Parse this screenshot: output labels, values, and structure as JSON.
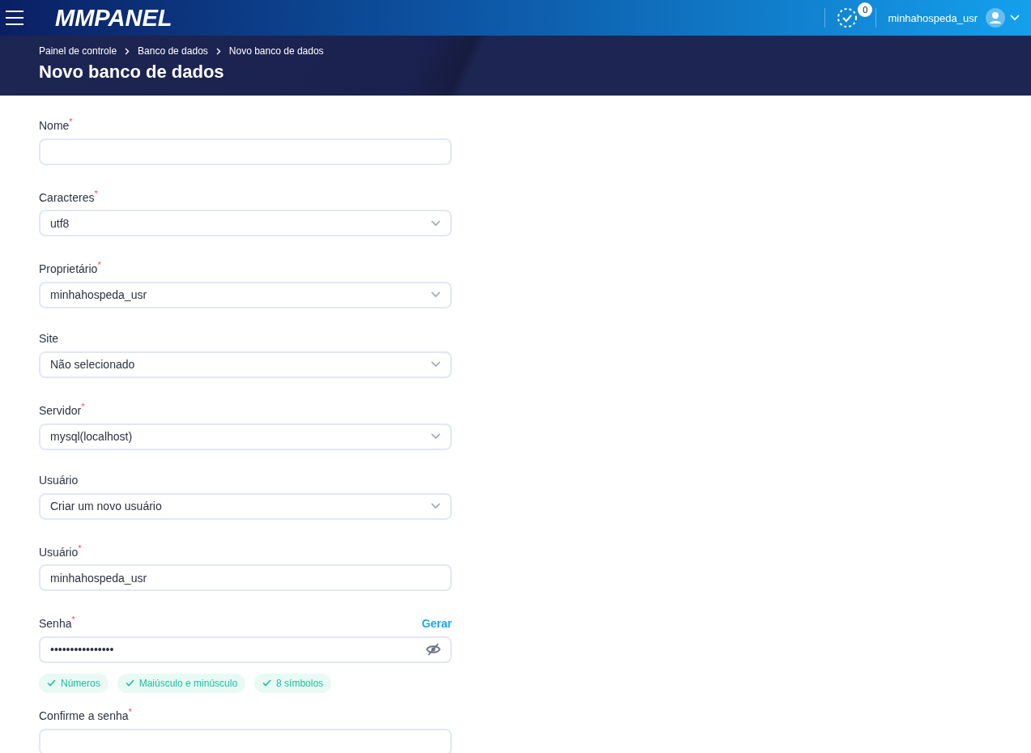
{
  "topbar": {
    "logo": "MMPANEL",
    "notifications_count": "0",
    "username": "minhahospeda_usr"
  },
  "breadcrumb": [
    "Painel de controle",
    "Banco de dados",
    "Novo banco de dados"
  ],
  "page_title": "Novo banco de dados",
  "fields": [
    {
      "kind": "text",
      "label": "Nome",
      "required_mark": "*"
    },
    {
      "kind": "select",
      "label": "Caracteres",
      "required_mark": "*",
      "value": "utf8"
    },
    {
      "kind": "select",
      "label": "Proprietário",
      "required_mark": "*",
      "value": "minhahospeda_usr"
    },
    {
      "kind": "select",
      "label": "Site",
      "value": "Não selecionado"
    },
    {
      "kind": "select",
      "label": "Servidor",
      "required_mark": "*",
      "value": "mysql(localhost)"
    },
    {
      "kind": "select",
      "label": "Usuário",
      "value": "Criar um novo usuário"
    },
    {
      "kind": "text",
      "label": "Usuário",
      "required_mark": "*",
      "value": "minhahospeda_usr"
    },
    {
      "kind": "password",
      "label": "Senha",
      "required_mark": "*",
      "value": "••••••••••••••••",
      "action": "Gerar",
      "requirements": [
        {
          "label": "Números",
          "met": true
        },
        {
          "label": "Maiúsculo e minúsculo",
          "met": true
        },
        {
          "label": "8 símbolos",
          "met": true
        }
      ]
    },
    {
      "kind": "password",
      "label": "Confirme a senha",
      "required_mark": "*"
    }
  ]
}
